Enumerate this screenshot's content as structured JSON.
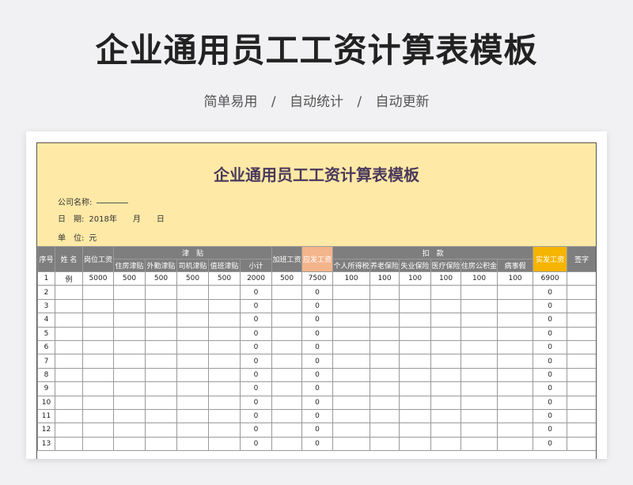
{
  "page": {
    "title": "企业通用员工工资计算表模板",
    "subtitle": [
      "简单易用",
      "/",
      "自动统计",
      "/",
      "自动更新"
    ]
  },
  "sheet": {
    "title": "企业通用员工工资计算表模板",
    "company_label": "公司名称:",
    "date_label": "日　期:",
    "date_value": "2018年　　月　　日",
    "unit_label": "单　位:",
    "unit_value": "元"
  },
  "table": {
    "groups": {
      "index": "序号",
      "name": "姓 名",
      "base": "岗位工资",
      "allowance": "津　贴",
      "overtime": "加班工资",
      "payable": "应发工资",
      "deduction": "扣　款",
      "net": "实发工资",
      "sign": "签字"
    },
    "allowance_cols": [
      "住房津贴",
      "外勤津贴",
      "司机津贴",
      "值班津贴",
      "小计"
    ],
    "deduction_cols": [
      "个人所得税",
      "养老保险",
      "失业保险",
      "医疗保险",
      "住房公积金",
      "病事假"
    ],
    "rows": [
      [
        "1",
        "例",
        "5000",
        "500",
        "500",
        "500",
        "500",
        "2000",
        "500",
        "7500",
        "100",
        "100",
        "100",
        "100",
        "100",
        "100",
        "6900",
        ""
      ],
      [
        "2",
        "",
        "",
        "",
        "",
        "",
        "",
        "0",
        "",
        "0",
        "",
        "",
        "",
        "",
        "",
        "",
        "0",
        ""
      ],
      [
        "3",
        "",
        "",
        "",
        "",
        "",
        "",
        "0",
        "",
        "0",
        "",
        "",
        "",
        "",
        "",
        "",
        "0",
        ""
      ],
      [
        "4",
        "",
        "",
        "",
        "",
        "",
        "",
        "0",
        "",
        "0",
        "",
        "",
        "",
        "",
        "",
        "",
        "0",
        ""
      ],
      [
        "5",
        "",
        "",
        "",
        "",
        "",
        "",
        "0",
        "",
        "0",
        "",
        "",
        "",
        "",
        "",
        "",
        "0",
        ""
      ],
      [
        "6",
        "",
        "",
        "",
        "",
        "",
        "",
        "0",
        "",
        "0",
        "",
        "",
        "",
        "",
        "",
        "",
        "0",
        ""
      ],
      [
        "7",
        "",
        "",
        "",
        "",
        "",
        "",
        "0",
        "",
        "0",
        "",
        "",
        "",
        "",
        "",
        "",
        "0",
        ""
      ],
      [
        "8",
        "",
        "",
        "",
        "",
        "",
        "",
        "0",
        "",
        "0",
        "",
        "",
        "",
        "",
        "",
        "",
        "0",
        ""
      ],
      [
        "9",
        "",
        "",
        "",
        "",
        "",
        "",
        "0",
        "",
        "0",
        "",
        "",
        "",
        "",
        "",
        "",
        "0",
        ""
      ],
      [
        "10",
        "",
        "",
        "",
        "",
        "",
        "",
        "0",
        "",
        "0",
        "",
        "",
        "",
        "",
        "",
        "",
        "0",
        ""
      ],
      [
        "11",
        "",
        "",
        "",
        "",
        "",
        "",
        "0",
        "",
        "0",
        "",
        "",
        "",
        "",
        "",
        "",
        "0",
        ""
      ],
      [
        "12",
        "",
        "",
        "",
        "",
        "",
        "",
        "0",
        "",
        "0",
        "",
        "",
        "",
        "",
        "",
        "",
        "0",
        ""
      ],
      [
        "13",
        "",
        "",
        "",
        "",
        "",
        "",
        "0",
        "",
        "0",
        "",
        "",
        "",
        "",
        "",
        "",
        "0",
        ""
      ]
    ]
  },
  "colors": {
    "banner": "#ffe9a6",
    "header_gray": "#7e7e7e",
    "payable_orange": "#f4b48c",
    "net_yellow": "#f5b400"
  }
}
